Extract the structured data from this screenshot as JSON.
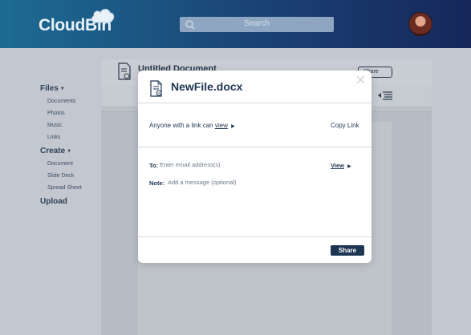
{
  "app": {
    "logo": "CloudBin",
    "search": {
      "placeholder": "Search"
    }
  },
  "sidebar": {
    "files": {
      "label": "Files",
      "items": [
        "Documents",
        "Photos",
        "Music",
        "Links"
      ]
    },
    "create": {
      "label": "Create",
      "items": [
        "Document",
        "Slide Deck",
        "Spread Sheet"
      ]
    },
    "upload": {
      "label": "Upload"
    }
  },
  "document": {
    "title": "Untitled Document",
    "share_label": "Share"
  },
  "modal": {
    "title": "NewFile.docx",
    "link_text": "Anyone with a link can",
    "link_permission": "view",
    "copy_link": "Copy Link",
    "to_label": "To:",
    "to_placeholder": "Enter email address(s)",
    "to_permission": "View",
    "note_label": "Note:",
    "note_placeholder": "Add a message (optional)",
    "share_button": "Share"
  },
  "colors": {
    "navy": "#1c3552",
    "topbar_start": "#1d6b93",
    "topbar_end": "#16275a"
  }
}
